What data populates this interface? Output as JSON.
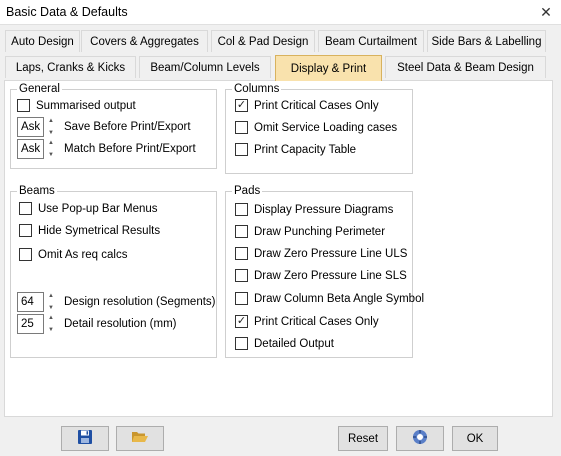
{
  "window": {
    "title": "Basic Data & Defaults",
    "close_glyph": "✕"
  },
  "tabs_row1": [
    "Auto Design",
    "Covers & Aggregates",
    "Col & Pad Design",
    "Beam Curtailment",
    "Side Bars & Labelling"
  ],
  "tabs_row2": [
    "Laps, Cranks & Kicks",
    "Beam/Column Levels",
    "Display & Print",
    "Steel Data & Beam Design"
  ],
  "active_tab": "Display & Print",
  "general": {
    "title": "General",
    "summarised_output": {
      "label": "Summarised output",
      "checked": false
    },
    "save_before_print": {
      "value": "Ask",
      "label": "Save Before Print/Export"
    },
    "match_before_print": {
      "value": "Ask",
      "label": "Match Before Print/Export"
    }
  },
  "columns": {
    "title": "Columns",
    "items": [
      {
        "label": "Print Critical Cases Only",
        "checked": true
      },
      {
        "label": "Omit Service Loading cases",
        "checked": false
      },
      {
        "label": "Print Capacity Table",
        "checked": false
      }
    ]
  },
  "beams": {
    "title": "Beams",
    "items": [
      {
        "label": "Use Pop-up Bar Menus",
        "checked": false
      },
      {
        "label": "Hide Symetrical Results",
        "checked": false
      },
      {
        "label": "Omit As req calcs",
        "checked": false
      }
    ],
    "design_resolution": {
      "value": "64",
      "label": "Design resolution (Segments)"
    },
    "detail_resolution": {
      "value": "25",
      "label": "Detail resolution (mm)"
    }
  },
  "pads": {
    "title": "Pads",
    "items": [
      {
        "label": "Display Pressure Diagrams",
        "checked": false
      },
      {
        "label": "Draw Punching Perimeter",
        "checked": false
      },
      {
        "label": "Draw Zero Pressure Line ULS",
        "checked": false
      },
      {
        "label": "Draw Zero Pressure Line SLS",
        "checked": false
      },
      {
        "label": "Draw Column Beta Angle Symbol",
        "checked": false
      },
      {
        "label": "Print Critical Cases Only",
        "checked": true
      },
      {
        "label": "Detailed Output",
        "checked": false
      }
    ]
  },
  "buttons": {
    "save_icon": "floppy-disk-icon",
    "open_icon": "folder-open-icon",
    "reset": "Reset",
    "help_icon": "help-settings-icon",
    "ok": "OK"
  },
  "colors": {
    "active_tab": "#f9e2ad",
    "active_tab_border": "#d8b25e",
    "save_icon": "#1f4fa3",
    "folder_icon": "#e8b84a"
  }
}
